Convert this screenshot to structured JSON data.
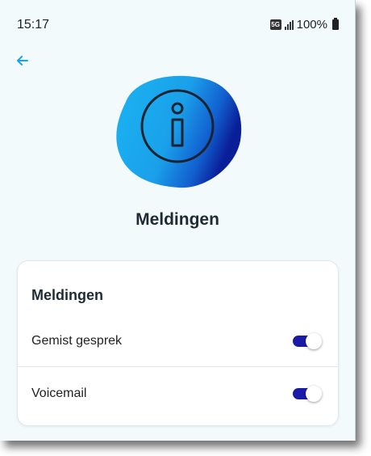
{
  "status_bar": {
    "time": "15:17",
    "network": "5G",
    "battery": "100%"
  },
  "header": {
    "back_icon": "arrow-left-icon"
  },
  "hero": {
    "icon": "info-icon"
  },
  "page_title": "Meldingen",
  "card": {
    "title": "Meldingen",
    "settings": [
      {
        "label": "Gemist gesprek",
        "enabled": true
      },
      {
        "label": "Voicemail",
        "enabled": true
      }
    ]
  },
  "colors": {
    "accent": "#1a1aa8",
    "back_arrow": "#1aa3e8",
    "blob_light": "#1ab0f0",
    "blob_dark": "#0a2a9e",
    "background": "#f3fafc"
  }
}
